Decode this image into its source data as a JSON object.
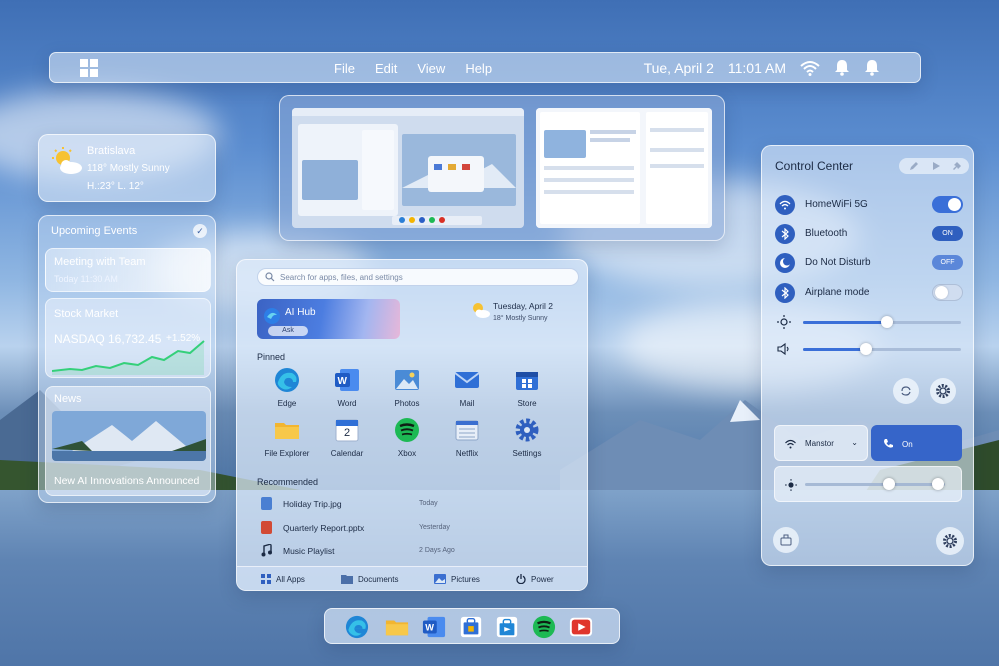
{
  "topbar": {
    "menu": [
      "File",
      "Edit",
      "View",
      "Help"
    ],
    "date": "Tue, April 2",
    "time": "11:01 AM",
    "icons": [
      "windows-logo-icon",
      "wifi-icon",
      "bell-icon",
      "notification-icon"
    ]
  },
  "weather": {
    "city": "Bratislava",
    "condition": "118° Mostly Sunny",
    "hilo": "H.:23° L. 12°"
  },
  "events": {
    "header": "Upcoming Events",
    "meeting": {
      "title": "Meeting with Team",
      "time": "Today 11:30 AM"
    },
    "stock": {
      "title": "Stock Market",
      "index": "NASDAQ 16,732.45",
      "change": "+1.52%"
    },
    "news": {
      "title": "News",
      "headline": "New AI Innovations Announced"
    }
  },
  "start": {
    "search_placeholder": "Search for apps, files, and settings",
    "ai_hub": {
      "title": "AI Hub",
      "ask": "Ask"
    },
    "weather": {
      "date": "Tuesday, April 2",
      "condition": "18° Mostly Sunny"
    },
    "pinned_label": "Pinned",
    "pinned": [
      {
        "name": "Edge",
        "icon": "edge-icon"
      },
      {
        "name": "Word",
        "icon": "word-icon"
      },
      {
        "name": "Photos",
        "icon": "photos-icon"
      },
      {
        "name": "Mail",
        "icon": "mail-icon"
      },
      {
        "name": "Store",
        "icon": "store-icon"
      },
      {
        "name": "File Explorer",
        "icon": "folder-icon"
      },
      {
        "name": "Calendar",
        "icon": "calendar-icon"
      },
      {
        "name": "Xbox",
        "icon": "xbox-icon"
      },
      {
        "name": "Netflix",
        "icon": "netflix-icon"
      },
      {
        "name": "Settings",
        "icon": "settings-icon"
      }
    ],
    "calendar_day": "2",
    "recommended_label": "Recommended",
    "recommended": [
      {
        "name": "Holiday Trip.jpg",
        "when": "Today"
      },
      {
        "name": "Quarterly Report.pptx",
        "when": "Yesterday"
      },
      {
        "name": "Music Playlist",
        "when": "2 Days Ago"
      }
    ],
    "footer": [
      "All Apps",
      "Documents",
      "Pictures",
      "Power"
    ]
  },
  "control_center": {
    "title": "Control Center",
    "rows": [
      {
        "label": "HomeWiFi 5G",
        "state": "on"
      },
      {
        "label": "Bluetooth",
        "state": "ON"
      },
      {
        "label": "Do Not Disturb",
        "state": "OFF"
      },
      {
        "label": "Airplane mode",
        "state": "off"
      }
    ],
    "brightness_level": 0.53,
    "volume_level": 0.4,
    "tile_wifi": "Manstor",
    "tile_call": "On",
    "tile_slider_levels": [
      0.6,
      0.95
    ]
  },
  "taskbar": {
    "icons": [
      "edge-icon",
      "folder-icon",
      "word-icon",
      "store-icon",
      "store-bag-icon",
      "spotify-icon",
      "youtube-icon"
    ]
  },
  "colors": {
    "accent": "#3a6fd8",
    "accent_dark": "#2f5fbf",
    "stock_line": "#35d07a"
  }
}
